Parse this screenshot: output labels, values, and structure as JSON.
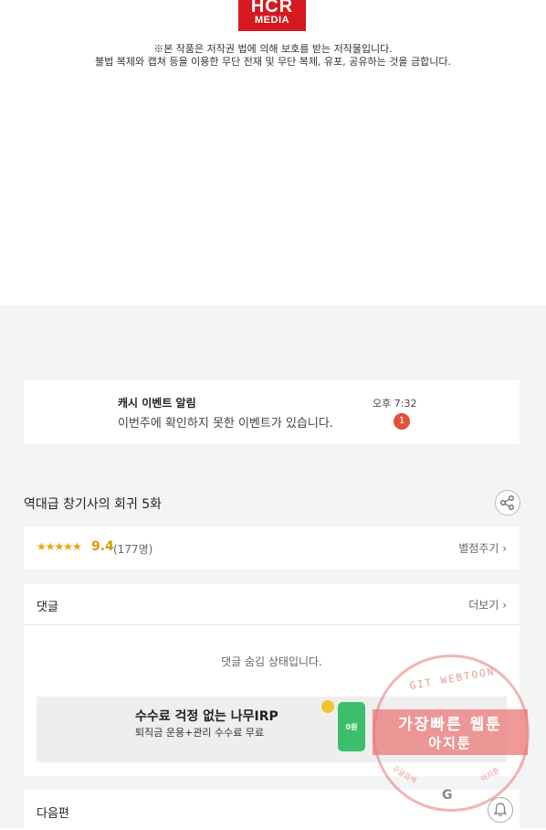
{
  "logo": {
    "line1": "HCR",
    "line2": "MEDIA"
  },
  "copyright": {
    "line1": "※본 작품은 저작권 법에 의해 보호를 받는 저작물입니다.",
    "line2": "불법 복제와 캡쳐 등을 이용한 무단 전재 및 무단 복제, 유포, 공유하는 것을 금합니다."
  },
  "notification": {
    "title": "캐시 이벤트 알림",
    "message": "이번주에 확인하지 못한 이벤트가 있습니다.",
    "time": "오후 7:32",
    "badge": "1"
  },
  "episode": {
    "title": "역대급 창기사의 회귀 5화"
  },
  "rating": {
    "stars": "★★★★★",
    "score": "9.4",
    "count": "(177명)",
    "give_label": "별점주기 ›"
  },
  "comments": {
    "header": "댓글",
    "more_label": "더보기 ›",
    "hidden_message": "댓글 숨김 상태입니다."
  },
  "ad": {
    "headline": "수수료 걱정 없는 나무IRP",
    "subline": "퇴직금 운용+관리 수수료 무료",
    "badge_text": "0원"
  },
  "next_episode": {
    "header": "다음편"
  },
  "watermark": {
    "arc_text": "GIT WEBTOON",
    "line1": "가장빠른 웹툰",
    "line2": "아지툰",
    "bottom_left": "구글검색",
    "bottom_right": "아지툰",
    "g": "G"
  },
  "colors": {
    "accent": "#d99a00",
    "badge": "#e0533b",
    "logo": "#d41a20"
  }
}
